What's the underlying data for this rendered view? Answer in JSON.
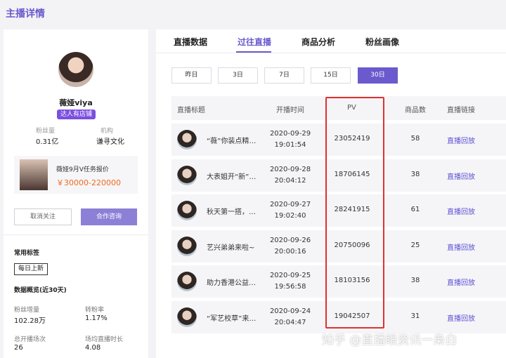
{
  "page": {
    "title": "主播详情"
  },
  "anchor": {
    "name": "薇娅viya",
    "badge": "达人有店铺",
    "fans_label": "粉丝量",
    "fans_value": "0.31亿",
    "org_label": "机构",
    "org_value": "谦寻文化"
  },
  "task": {
    "title": "薇娅9月V任务报价",
    "price": "￥30000-220000"
  },
  "actions": {
    "unfollow": "取消关注",
    "consult": "合作咨询"
  },
  "tags": {
    "title": "常用标签",
    "items": [
      "每日上新"
    ]
  },
  "overview": {
    "title": "数据概览(近30天)",
    "items": [
      {
        "label": "粉丝增量",
        "value": "102.28万"
      },
      {
        "label": "转粉率",
        "value": "1.17%"
      },
      {
        "label": "总开播场次",
        "value": "26"
      },
      {
        "label": "场均直播时长",
        "value": "4.08"
      }
    ]
  },
  "tabs": [
    {
      "label": "直播数据",
      "active": false
    },
    {
      "label": "过往直播",
      "active": true
    },
    {
      "label": "商品分析",
      "active": false
    },
    {
      "label": "粉丝画像",
      "active": false
    }
  ],
  "ranges": [
    {
      "label": "昨日",
      "active": false
    },
    {
      "label": "3日",
      "active": false
    },
    {
      "label": "7日",
      "active": false
    },
    {
      "label": "15日",
      "active": false
    },
    {
      "label": "30日",
      "active": true
    }
  ],
  "table": {
    "headers": {
      "title": "直播标题",
      "time": "开播时间",
      "pv": "PV",
      "goods": "商品数",
      "link": "直播链接"
    },
    "rows": [
      {
        "title": "“薇”你装点精…",
        "date": "2020-09-29",
        "time": "19:01:54",
        "pv": "23052419",
        "goods": "58",
        "link": "直播回放"
      },
      {
        "title": "大表姐开“新”…",
        "date": "2020-09-28",
        "time": "20:04:12",
        "pv": "18706145",
        "goods": "38",
        "link": "直播回放"
      },
      {
        "title": "秋天第一搭，…",
        "date": "2020-09-27",
        "time": "19:02:40",
        "pv": "28241915",
        "goods": "61",
        "link": "直播回放"
      },
      {
        "title": "艺兴弟弟来啦~",
        "date": "2020-09-26",
        "time": "20:00:16",
        "pv": "20750096",
        "goods": "25",
        "link": "直播回放"
      },
      {
        "title": "助力香港公益…",
        "date": "2020-09-25",
        "time": "19:56:58",
        "pv": "18103156",
        "goods": "38",
        "link": "直播回放"
      },
      {
        "title": "“军艺校草”来…",
        "date": "2020-09-24",
        "time": "20:04:47",
        "pv": "19042507",
        "goods": "31",
        "link": "直播回放"
      }
    ]
  },
  "watermark": "知乎 @直播眼资讯一枭白",
  "colors": {
    "accent": "#6a5acd",
    "badge": "#7b4fe0",
    "price": "#ee6a1f",
    "highlight": "#e03030"
  }
}
